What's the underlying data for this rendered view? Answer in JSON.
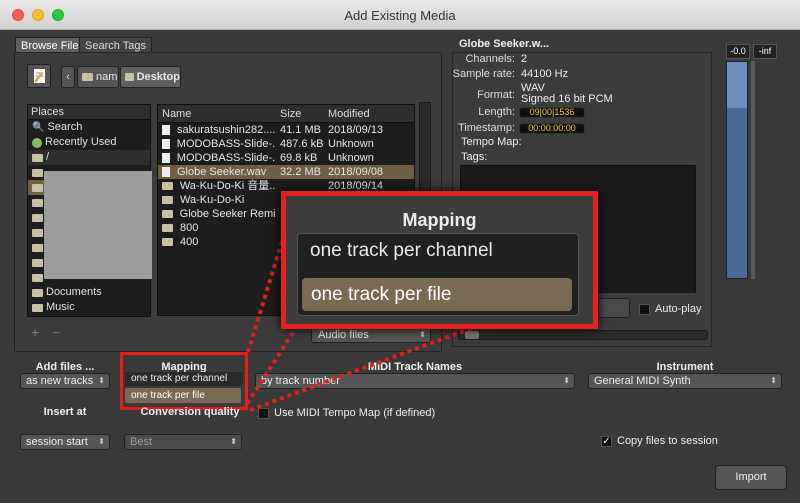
{
  "window": {
    "title": "Add Existing Media"
  },
  "tabs": [
    {
      "label": "Browse Files"
    },
    {
      "label": "Search Tags"
    }
  ],
  "path": {
    "seg1": "nam",
    "seg2": "Desktop"
  },
  "places": {
    "header": "Places",
    "items": [
      {
        "label": "Search",
        "icon": "search-icon"
      },
      {
        "label": "Recently Used",
        "icon": "recent-icon"
      },
      {
        "label": "/",
        "icon": "folder-icon"
      }
    ],
    "bottom": [
      {
        "label": "Documents"
      },
      {
        "label": "Music"
      }
    ],
    "add": "+",
    "remove": "−"
  },
  "files": {
    "columns": {
      "name": "Name",
      "size": "Size",
      "modified": "Modified"
    },
    "rows": [
      {
        "name": "sakuratsushin282....",
        "size": "41.1 MB",
        "modified": "2018/09/13",
        "type": "file"
      },
      {
        "name": "MODOBASS-Slide-...",
        "size": "487.6 kB",
        "modified": "Unknown",
        "type": "file"
      },
      {
        "name": "MODOBASS-Slide-...",
        "size": "69.8 kB",
        "modified": "Unknown",
        "type": "file"
      },
      {
        "name": "Globe Seeker.wav",
        "size": "32.2 MB",
        "modified": "2018/09/08",
        "type": "file",
        "selected": true
      },
      {
        "name": "Wa-Ku-Do-Ki 音量...",
        "size": "",
        "modified": "2018/09/14",
        "type": "folder"
      },
      {
        "name": "Wa-Ku-Do-Ki",
        "size": "",
        "modified": "",
        "type": "folder"
      },
      {
        "name": "Globe Seeker Remix",
        "size": "",
        "modified": "",
        "type": "folder"
      },
      {
        "name": "800",
        "size": "",
        "modified": "",
        "type": "folder"
      },
      {
        "name": "400",
        "size": "",
        "modified": "",
        "type": "folder"
      }
    ],
    "filter": "Audio files"
  },
  "info": {
    "title": "Globe Seeker.w...",
    "channels_label": "Channels:",
    "channels": "2",
    "rate_label": "Sample rate:",
    "rate": "44100 Hz",
    "format_label": "Format:",
    "format1": "WAV",
    "format2": "Signed 16 bit PCM",
    "length_label": "Length:",
    "length": "09|00|1536",
    "timestamp_label": "Timestamp:",
    "timestamp": "00:00:00:00",
    "tempo_label": "Tempo Map:",
    "tags_label": "Tags:",
    "autoplay": "Auto-play"
  },
  "meter": {
    "left": "-0.0",
    "right": "-inf"
  },
  "options": {
    "add_files_label": "Add files ...",
    "add_files_value": "as new tracks",
    "mapping_label": "Mapping",
    "mapping_value": "one track per channel",
    "mapping_option": "one track per file",
    "midi_names_label": "MIDI Track Names",
    "midi_names_value": "by track number",
    "instrument_label": "Instrument",
    "instrument_value": "General MIDI Synth",
    "insert_label": "Insert at",
    "insert_value": "session start",
    "quality_label": "Conversion quality",
    "quality_value": "Best",
    "midi_tempo": "Use MIDI Tempo Map (if defined)",
    "copy_files": "Copy files to session",
    "import": "Import"
  },
  "zoom": {
    "title": "Mapping",
    "option1": "one track per channel",
    "option2": "one track per file"
  },
  "colors": {
    "accent_red": "#e3201c",
    "selection": "#7a6a51",
    "clock": "#f3c641"
  }
}
